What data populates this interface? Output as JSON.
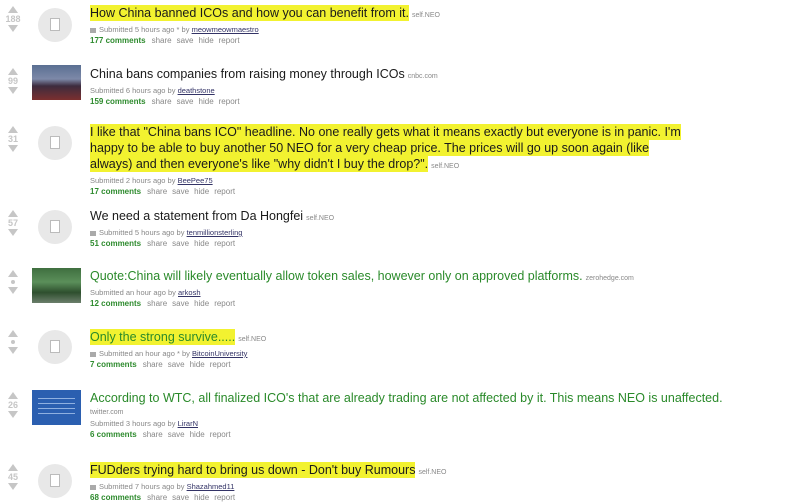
{
  "posts": [
    {
      "score": "188",
      "title": "How China banned ICOs and how you can benefit from it.",
      "domain": "self.NEO",
      "meta_prefix": "Submitted 5 hours ago * by",
      "author": "meowmeowmaestro",
      "comments": "177 comments",
      "thumb": "default",
      "highlight": true
    },
    {
      "score": "99",
      "title": "China bans companies from raising money through ICOs",
      "domain": "cnbc.com",
      "meta_prefix": "Submitted 6 hours ago by",
      "author": "deathstone",
      "comments": "159 comments",
      "thumb": "img1",
      "highlight": false
    },
    {
      "score": "31",
      "title": "I like that \"China bans ICO\" headline. No one really gets what it means exactly but everyone is in panic. I'm happy to be able to buy another 50 NEO for a very cheap price. The prices will go up soon again (like always) and then everyone's like \"why didn't I buy the drop?\".",
      "domain": "self.NEO",
      "meta_prefix": "Submitted 2 hours ago by",
      "author": "BeePee75",
      "comments": "17 comments",
      "thumb": "default",
      "highlight": true
    },
    {
      "score": "57",
      "title": "We need a statement from Da Hongfei",
      "domain": "self.NEO",
      "meta_prefix": "Submitted 5 hours ago by",
      "author": "tenmillionsterling",
      "comments": "51 comments",
      "thumb": "default",
      "highlight": false
    },
    {
      "score": "",
      "title": "Quote:China will likely eventually allow token sales, however only on approved platforms.",
      "domain": "zerohedge.com",
      "meta_prefix": "Submitted an hour ago by",
      "author": "arkosh",
      "comments": "12 comments",
      "thumb": "img2",
      "highlight": false,
      "green": true
    },
    {
      "score": "",
      "title": "Only the strong survive.....",
      "domain": "self.NEO",
      "meta_prefix": "Submitted an hour ago * by",
      "author": "BitcoinUniversity",
      "comments": "7 comments",
      "thumb": "default",
      "highlight": true,
      "green": true
    },
    {
      "score": "26",
      "title": "According to WTC, all finalized ICO's that are already trading are not affected by it. This means NEO is unaffected.",
      "domain": "twitter.com",
      "meta_prefix": "Submitted 3 hours ago by",
      "author": "LirarN",
      "comments": "6 comments",
      "thumb": "img3",
      "highlight": false,
      "green": true
    },
    {
      "score": "45",
      "title": "FUDders trying hard to bring us down - Don't buy Rumours",
      "domain": "self.NEO",
      "meta_prefix": "Submitted 7 hours ago by",
      "author": "Shazahmed11",
      "comments": "68 comments",
      "thumb": "default",
      "highlight": true
    }
  ],
  "actions": {
    "share": "share",
    "save": "save",
    "hide": "hide",
    "report": "report"
  }
}
